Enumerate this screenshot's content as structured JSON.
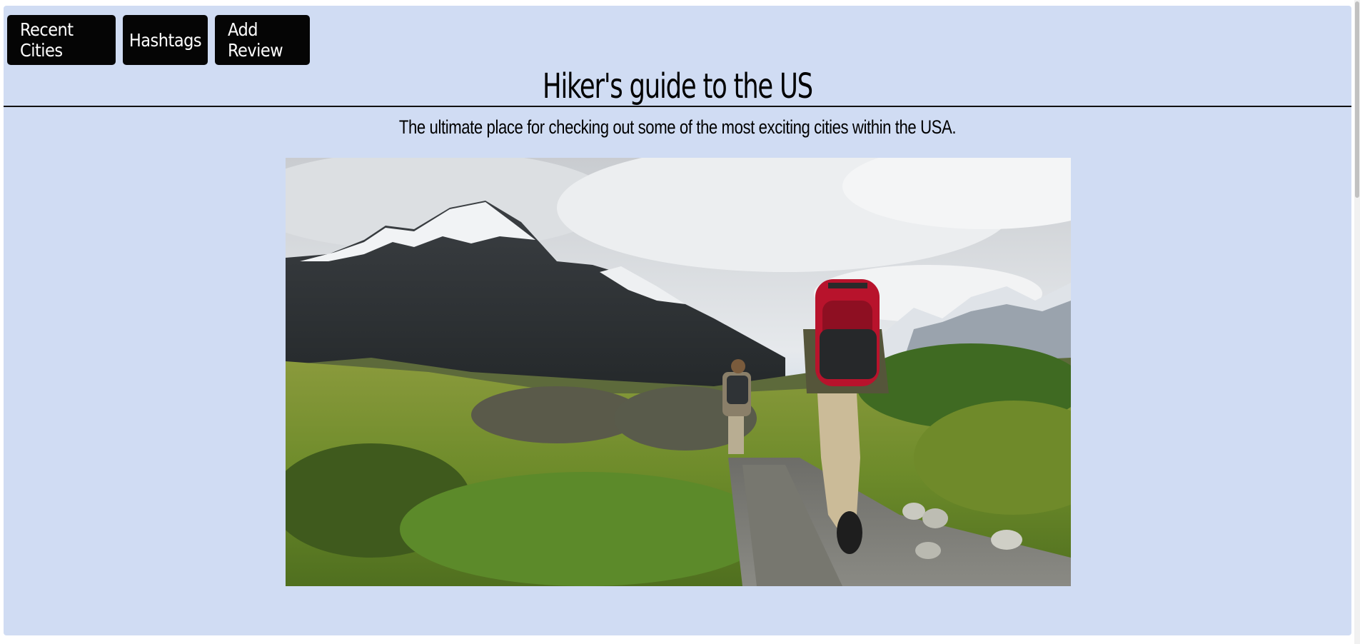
{
  "nav": {
    "recent_cities": "Recent Cities",
    "hashtags": "Hashtags",
    "add_review": "Add Review"
  },
  "header": {
    "title": "Hiker's guide to the US",
    "subtitle": "The ultimate place for checking out some of the most exciting cities within the USA."
  },
  "colors": {
    "page_background": "#d0dcf3",
    "button_background": "#050505",
    "button_text": "#ffffff"
  }
}
